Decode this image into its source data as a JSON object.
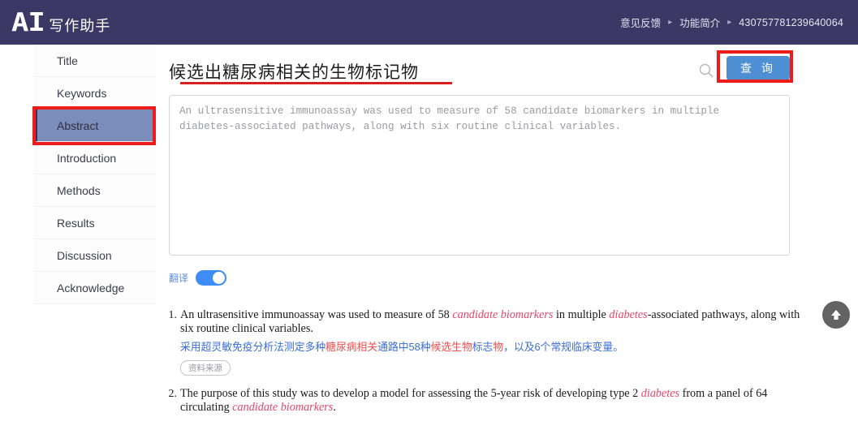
{
  "header": {
    "logo_text": "AI",
    "brand_name": "写作助手",
    "nav": [
      {
        "label": "意见反馈",
        "name": "feedback"
      },
      {
        "label": "功能简介",
        "name": "features"
      }
    ],
    "separator": "▸",
    "account_id": "430757781239640064",
    "bg_color": "#3b3866"
  },
  "sidebar": {
    "items": [
      {
        "label": "Title",
        "active": false
      },
      {
        "label": "Keywords",
        "active": false
      },
      {
        "label": "Abstract",
        "active": true
      },
      {
        "label": "Introduction",
        "active": false
      },
      {
        "label": "Methods",
        "active": false
      },
      {
        "label": "Results",
        "active": false
      },
      {
        "label": "Discussion",
        "active": false
      },
      {
        "label": "Acknowledge",
        "active": false
      }
    ],
    "active_bg": "#7b8ebb"
  },
  "main": {
    "doc_title": "候选出糖尿病相关的生物标记物",
    "search_icon": "search-icon",
    "query_button": "查 询",
    "query_button_color": "#4e8fd4",
    "editor_value": "An ultrasensitive immunoassay was used to measure of 58 candidate biomarkers in multiple diabetes-associated pathways, along with six routine clinical variables.",
    "editor_placeholder": "",
    "translate_label": "翻译",
    "translate_on": true
  },
  "results": [
    {
      "number": "1.",
      "en_parts": [
        {
          "text": "An ultrasensitive immunoassay was used to measure of 58 ",
          "hl": false
        },
        {
          "text": "candidate biomarkers",
          "hl": true
        },
        {
          "text": " in multiple ",
          "hl": false
        },
        {
          "text": "diabetes",
          "hl": true
        },
        {
          "text": "-associated pathways, along with six routine clinical variables.",
          "hl": false
        }
      ],
      "zh_parts": [
        {
          "text": "采用超灵敏免疫分析法测定多种",
          "hl": false
        },
        {
          "text": "糖尿病相关",
          "hl": true
        },
        {
          "text": "通路中58种",
          "hl": false
        },
        {
          "text": "候选生物",
          "hl": true
        },
        {
          "text": "标志",
          "hl": false
        },
        {
          "text": "物",
          "hl": true
        },
        {
          "text": "，以及6个常规临床变量。",
          "hl": false
        }
      ],
      "source_tag": "资料来源"
    },
    {
      "number": "2.",
      "en_parts": [
        {
          "text": "The purpose of this study was to develop a model for assessing the 5-year risk of developing type 2 ",
          "hl": false
        },
        {
          "text": "diabetes",
          "hl": true
        },
        {
          "text": " from a panel of 64 circulating ",
          "hl": false
        },
        {
          "text": "candidate biomarkers",
          "hl": true
        },
        {
          "text": ".",
          "hl": false
        }
      ],
      "zh_parts": [],
      "source_tag": ""
    }
  ],
  "annotations": {
    "highlight_color": "#ee1b1b",
    "title_underline": true,
    "sidebar_box": true,
    "query_box": true
  },
  "scroll_top": {
    "icon": "arrow-up-circle-icon"
  }
}
